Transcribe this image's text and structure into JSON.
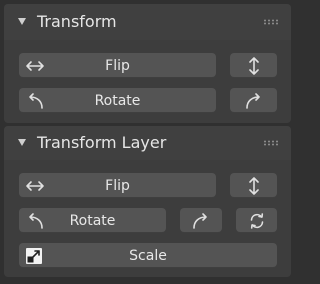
{
  "panels": [
    {
      "title": "Transform",
      "buttons": {
        "flip": "Flip",
        "rotate": "Rotate"
      },
      "icons": [
        "flip-horizontal-icon",
        "flip-vertical-icon",
        "rotate-left-icon",
        "rotate-right-icon"
      ]
    },
    {
      "title": "Transform Layer",
      "buttons": {
        "flip": "Flip",
        "rotate": "Rotate",
        "scale": "Scale"
      },
      "icons": [
        "flip-horizontal-icon",
        "flip-vertical-icon",
        "rotate-left-icon",
        "rotate-right-icon",
        "reset-rotation-icon",
        "scale-icon"
      ]
    }
  ]
}
